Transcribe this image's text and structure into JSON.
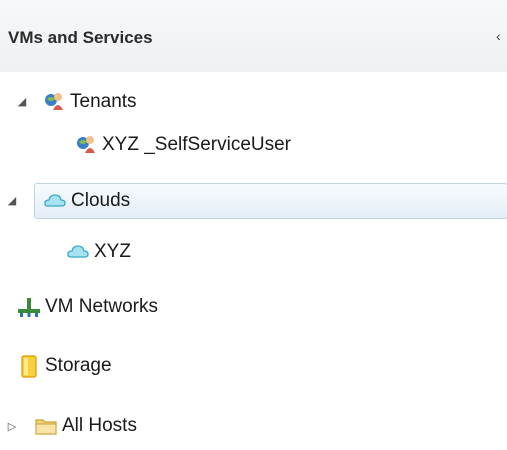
{
  "panel": {
    "title": "VMs and Services",
    "collapse_glyph": "‹"
  },
  "tree": {
    "tenants": {
      "label": "Tenants",
      "icon": "tenant-icon",
      "expanded": true
    },
    "tenant_user": {
      "label": "XYZ _SelfServiceUser",
      "icon": "tenant-icon"
    },
    "clouds": {
      "label": "Clouds",
      "icon": "cloud-icon",
      "expanded": true,
      "selected": true
    },
    "cloud_xyz": {
      "label": "XYZ",
      "icon": "cloud-icon"
    },
    "vm_networks": {
      "label": "VM Networks",
      "icon": "network-icon"
    },
    "storage": {
      "label": "Storage",
      "icon": "storage-icon"
    },
    "all_hosts": {
      "label": "All Hosts",
      "icon": "folder-icon",
      "expanded": false
    }
  },
  "glyphs": {
    "expanded": "◢",
    "collapsed": "▷"
  },
  "colors": {
    "selection_bg": "#e3eef7",
    "selection_border": "#c2d3e3",
    "cloud": "#5bc0d8",
    "storage": "#f5b800",
    "folder": "#e8c25a"
  }
}
